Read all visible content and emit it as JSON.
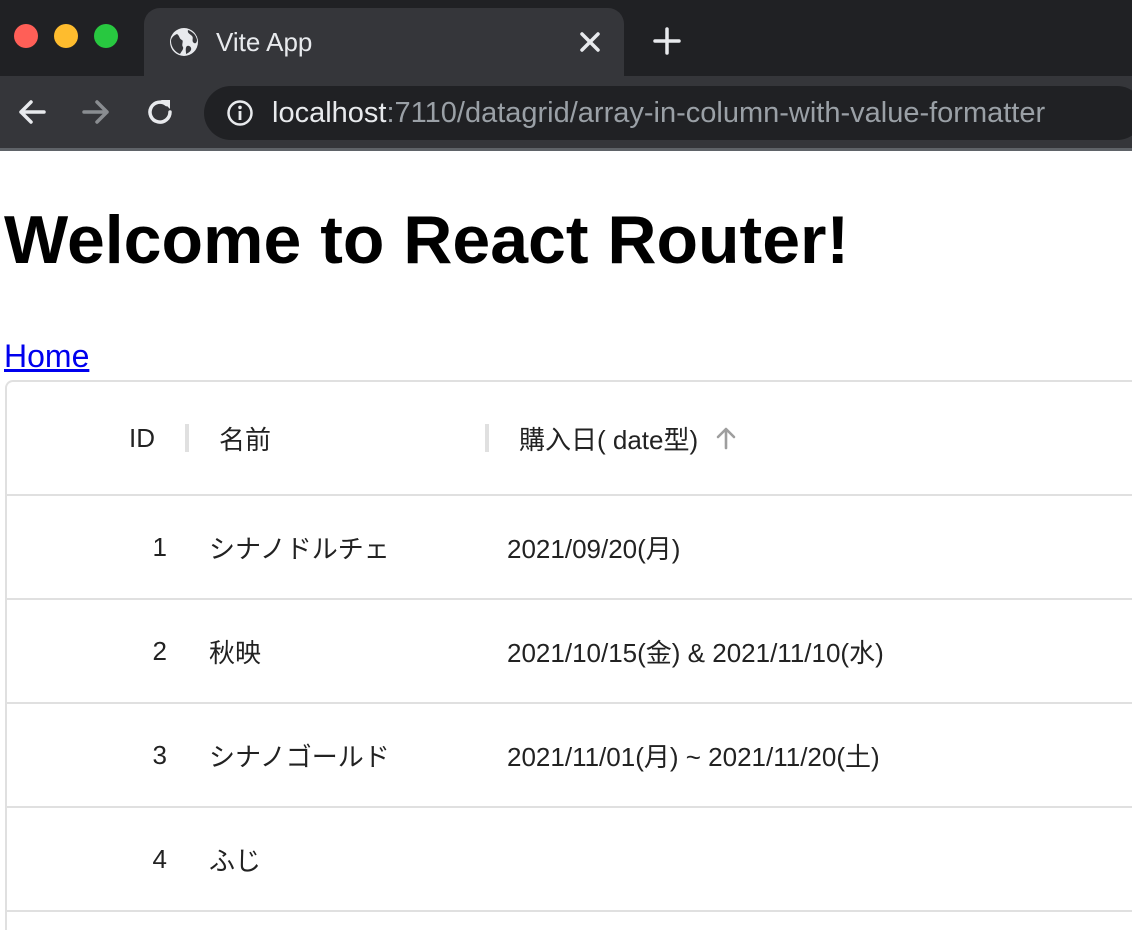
{
  "browser": {
    "tab_title": "Vite App",
    "url_host": "localhost",
    "url_rest": ":7110/datagrid/array-in-column-with-value-formatter"
  },
  "page": {
    "title": "Welcome to React Router!",
    "home_link": "Home"
  },
  "grid": {
    "columns": [
      {
        "label": "ID"
      },
      {
        "label": "名前"
      },
      {
        "label": "購入日( date型)",
        "sort": "ascending"
      }
    ],
    "rows": [
      {
        "id": "1",
        "name": "シナノドルチェ",
        "date": "2021/09/20(月)"
      },
      {
        "id": "2",
        "name": "秋映",
        "date": "2021/10/15(金) & 2021/11/10(水)"
      },
      {
        "id": "3",
        "name": "シナノゴールド",
        "date": "2021/11/01(月) ~ 2021/11/20(土)"
      },
      {
        "id": "4",
        "name": "ふじ",
        "date": ""
      }
    ]
  },
  "icons": {
    "tab_favicon": "globe-icon",
    "tab_close": "close-icon",
    "new_tab": "plus-icon",
    "back": "arrow-left-icon",
    "forward": "arrow-right-icon",
    "reload": "reload-icon",
    "site_info": "info-icon",
    "sort": "arrow-up-icon"
  },
  "colors": {
    "chrome_dark": "#202124",
    "chrome_tab": "#35363a",
    "link": "#0000ee",
    "grid_border": "#e0e0e0"
  }
}
